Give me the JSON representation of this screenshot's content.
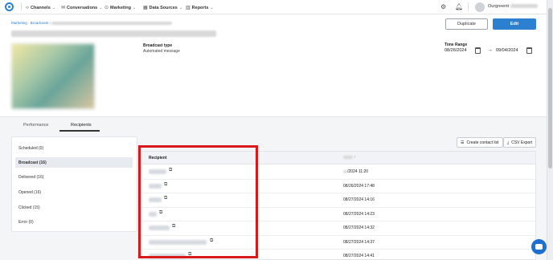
{
  "nav": {
    "items": [
      {
        "label": "Channels",
        "icon": "chevron-code-icon"
      },
      {
        "label": "Conversations",
        "icon": "chat-icon"
      },
      {
        "label": "Marketing",
        "icon": "broadcast-icon"
      },
      {
        "label": "Data Sources",
        "icon": "grid-icon"
      },
      {
        "label": "Reports",
        "icon": "chart-icon"
      }
    ],
    "org_name": "Ourgreentr"
  },
  "breadcrumb": "Marketing · Broadcasts ›",
  "broadcast_type": {
    "label": "Broadcast type",
    "value": "Automated message"
  },
  "buttons": {
    "duplicate": "Duplicate",
    "edit": "Edit"
  },
  "time_range": {
    "label": "Time Range",
    "start": "08/26/2024",
    "arrow": "→",
    "end": "09/04/2024"
  },
  "tabs": [
    {
      "label": "Performance",
      "active": false
    },
    {
      "label": "Recipients",
      "active": true
    }
  ],
  "filters": [
    {
      "label": "Scheduled (0)",
      "active": false
    },
    {
      "label": "Broadcast (16)",
      "active": true
    },
    {
      "label": "Delivered (16)",
      "active": false
    },
    {
      "label": "Opened (16)",
      "active": false
    },
    {
      "label": "Clicked (15)",
      "active": false
    },
    {
      "label": "Error (0)",
      "active": false
    }
  ],
  "actions": {
    "create_list": "Create contact list",
    "csv_export": "CSV Export"
  },
  "table": {
    "columns": {
      "recipient": "Recipient",
      "sent_arrow": "↑"
    },
    "rows": [
      {
        "date": "/2024 11:20"
      },
      {
        "date": "08/26/2024 17:48"
      },
      {
        "date": "08/27/2024 14:16"
      },
      {
        "date": "08/27/2024 14:23"
      },
      {
        "date": "08/27/2024 14:32"
      },
      {
        "date": "08/27/2024 14:37"
      },
      {
        "date": "08/27/2024 14:41"
      }
    ]
  },
  "colors": {
    "accent": "#2d7fd0",
    "highlight": "#d7191c"
  }
}
